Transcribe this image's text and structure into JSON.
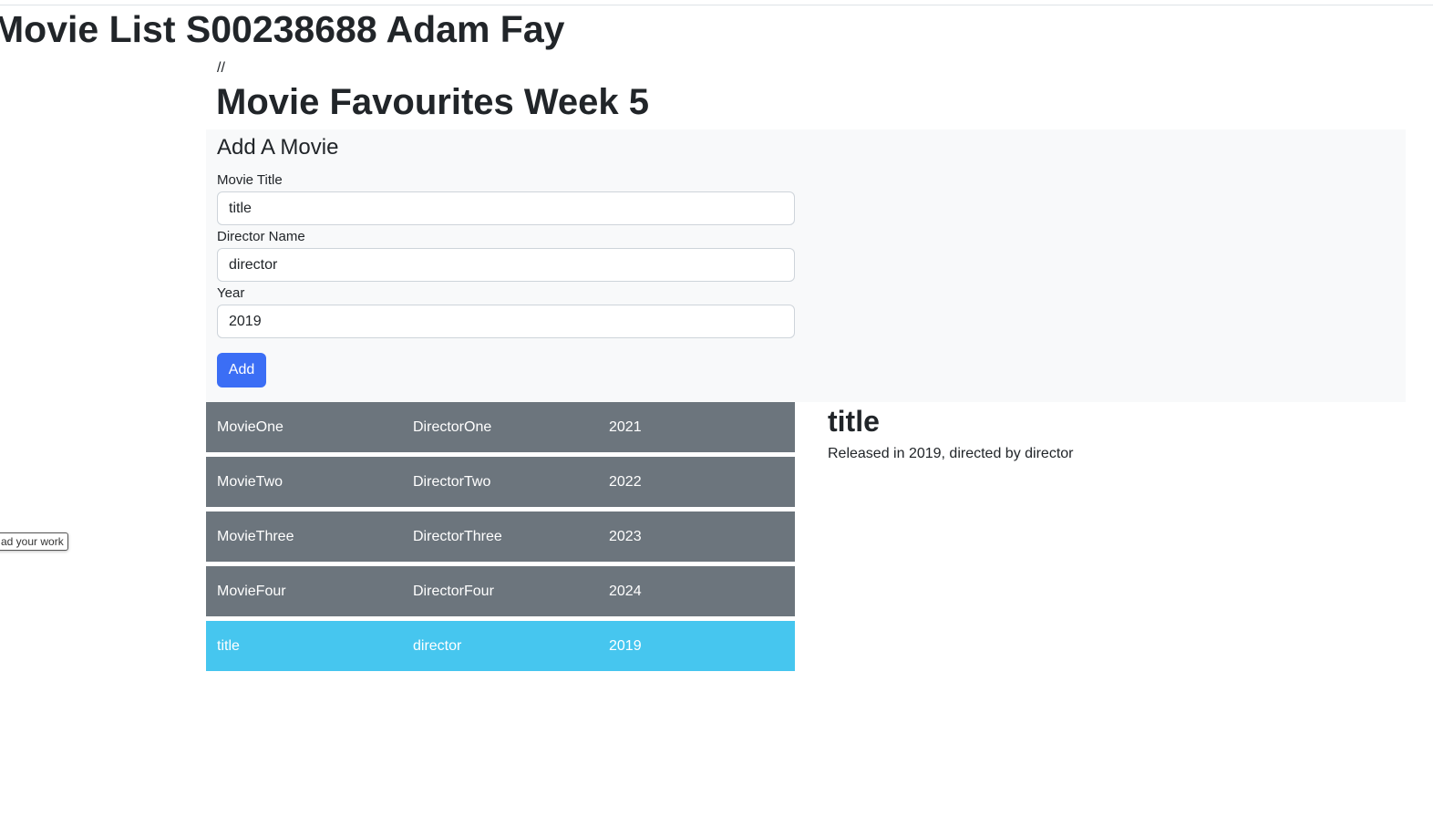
{
  "header": {
    "title": "Movie List S00238688 Adam Fay"
  },
  "app": {
    "comment_text": "//",
    "title": "Movie Favourites Week 5"
  },
  "form": {
    "heading": "Add A Movie",
    "title_label": "Movie Title",
    "title_value": "title",
    "director_label": "Director Name",
    "director_value": "director",
    "year_label": "Year",
    "year_value": "2019",
    "add_label": "Add",
    "accent_color": "#3b6ef5"
  },
  "movies": [
    {
      "title": "MovieOne",
      "director": "DirectorOne",
      "year": "2021"
    },
    {
      "title": "MovieTwo",
      "director": "DirectorTwo",
      "year": "2022"
    },
    {
      "title": "MovieThree",
      "director": "DirectorThree",
      "year": "2023"
    },
    {
      "title": "MovieFour",
      "director": "DirectorFour",
      "year": "2024"
    },
    {
      "title": "title",
      "director": "director",
      "year": "2019",
      "selected": true
    }
  ],
  "colors": {
    "row_default": "#6c757d",
    "row_selected": "#46c6ef"
  },
  "detail": {
    "title": "title",
    "description": "Released in 2019, directed by director"
  },
  "tooltip": {
    "text": "ad your work"
  }
}
